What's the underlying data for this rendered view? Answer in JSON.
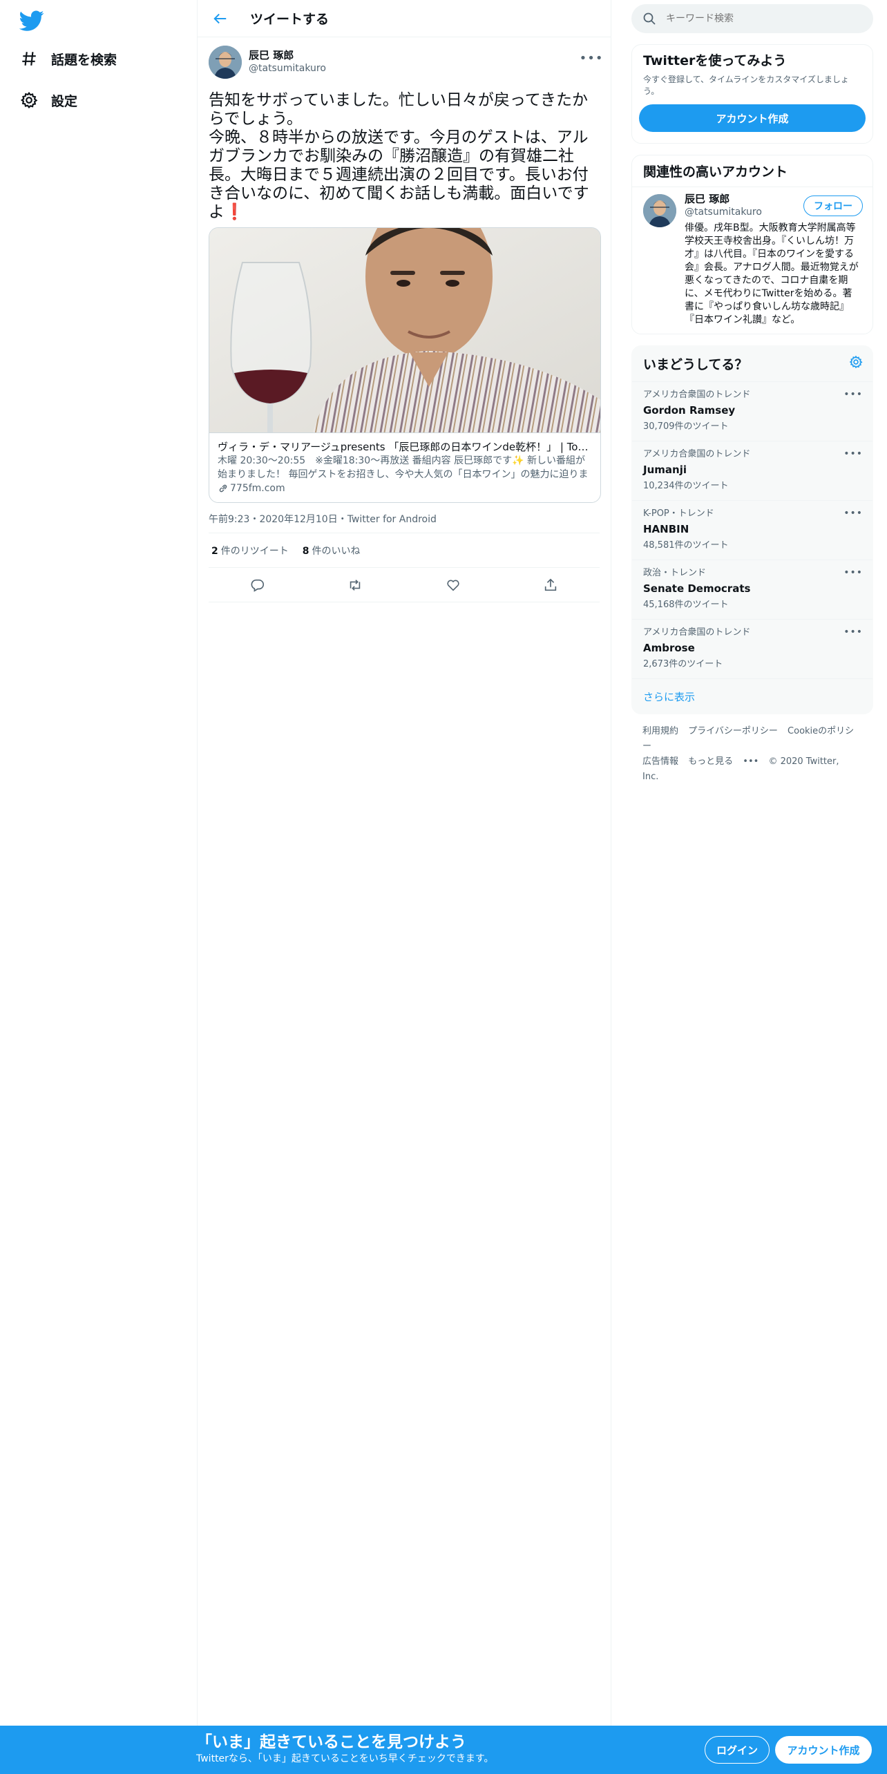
{
  "sidebar": {
    "logo_icon": "twitter-bird-icon",
    "items": [
      {
        "label": "話題を検索",
        "icon": "hashtag-icon"
      },
      {
        "label": "設定",
        "icon": "gear-icon"
      }
    ]
  },
  "header": {
    "title": "ツイートする",
    "back_icon": "arrow-left-icon"
  },
  "tweet": {
    "author_name": "辰巳 琢郎",
    "author_handle": "@tatsumitakuro",
    "text": "告知をサボっていました。忙しい日々が戻ってきたからでしょう。\n今晩、８時半からの放送です。今月のゲストは、アルガブランカでお馴染みの『勝沼醸造』の有賀雄二社長。大晦日まで５週連続出演の２回目です。長いお付き合いなのに、初めて聞くお話しも満載。面白いですよ",
    "emoji": "❗",
    "card": {
      "title": "ヴィラ・デ・マリアージュpresents 「辰巳琢郎の日本ワインde乾杯！」 | Tokyo FM",
      "description": "木曜 20:30〜20:55　※金曜18:30〜再放送 番組内容 辰巳琢郎です✨ 新しい番組が始まりました！ 毎回ゲストをお招きし、今や大人気の「日本ワイン」の魅力に迫ります。",
      "domain": "775fm.com"
    },
    "timestamp": "午前9:23・2020年12月10日・Twitter for Android",
    "retweet_count": "2",
    "retweet_label": "件のリツイート",
    "like_count": "8",
    "like_label": "件のいいね"
  },
  "search": {
    "placeholder": "キーワード検索"
  },
  "signup_panel": {
    "title": "Twitterを使ってみよう",
    "subtitle": "今すぐ登録して、タイムラインをカスタマイズしましょう。",
    "button": "アカウント作成"
  },
  "related": {
    "title": "関連性の高いアカウント",
    "name": "辰巳 琢郎",
    "handle": "@tatsumitakuro",
    "follow": "フォロー",
    "bio": "俳優。戌年B型。大阪教育大学附属高等学校天王寺校舎出身。『くいしん坊！万才』は八代目。『日本のワインを愛する会』会長。アナログ人間。最近物覚えが悪くなってきたので、コロナ自粛を期に、メモ代わりにTwitterを始める。著書に『やっぱり食いしん坊な歳時記』『日本ワイン礼讃』など。"
  },
  "trends": {
    "title": "いまどうしてる？",
    "items": [
      {
        "context": "アメリカ合衆国のトレンド",
        "name": "Gordon Ramsey",
        "count": "30,709件のツイート"
      },
      {
        "context": "アメリカ合衆国のトレンド",
        "name": "Jumanji",
        "count": "10,234件のツイート"
      },
      {
        "context": "K-POP・トレンド",
        "name": "HANBIN",
        "count": "48,581件のツイート"
      },
      {
        "context": "政治・トレンド",
        "name": "Senate Democrats",
        "count": "45,168件のツイート"
      },
      {
        "context": "アメリカ合衆国のトレンド",
        "name": "Ambrose",
        "count": "2,673件のツイート"
      }
    ],
    "show_more": "さらに表示"
  },
  "footer": {
    "terms": "利用規約",
    "privacy": "プライバシーポリシー",
    "cookie": "Cookieのポリシー",
    "ads": "広告情報",
    "more": "もっと見る",
    "copyright": "© 2020 Twitter, Inc."
  },
  "bottom_bar": {
    "title": "「いま」起きていることを見つけよう",
    "subtitle": "Twitterなら、「いま」起きていることをいち早くチェックできます。",
    "login": "ログイン",
    "signup": "アカウント作成"
  },
  "colors": {
    "accent": "#1d9bf0",
    "text": "#0f1419",
    "muted": "#536471"
  }
}
